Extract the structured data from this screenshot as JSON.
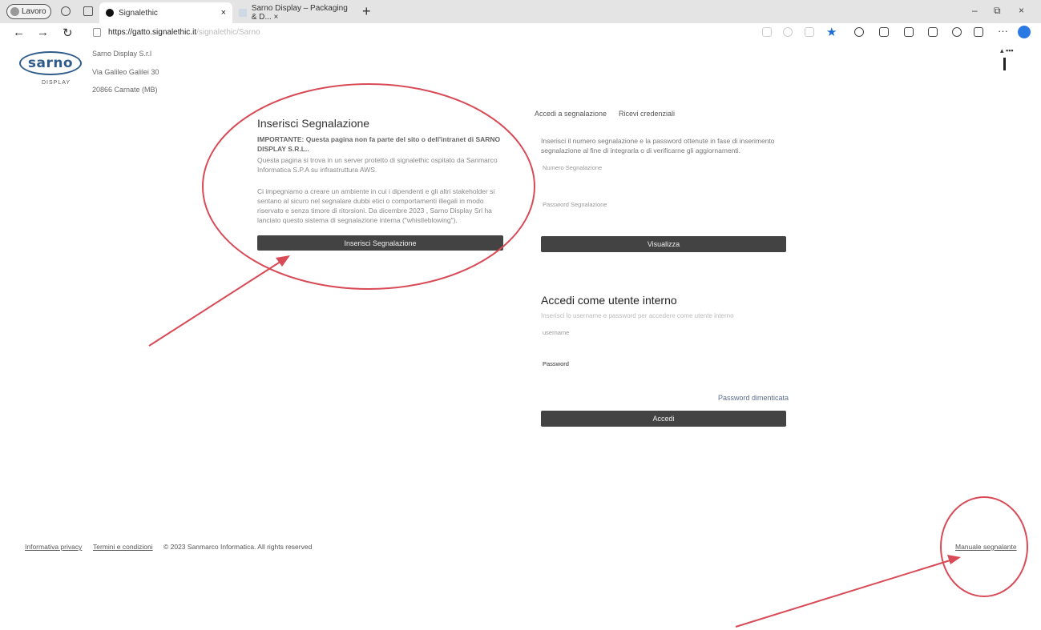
{
  "browser": {
    "profile_label": "Lavoro",
    "tabs": [
      {
        "title": "Signalethic",
        "close": "×"
      },
      {
        "title": "Sarno Display – Packaging & D... ×"
      }
    ],
    "new_tab": "+",
    "window_controls": [
      "–",
      "⧉",
      "×"
    ],
    "url_prefix": "https://gatto.signalethic.it",
    "url_faded": "/signalethic/Sarno",
    "more_label": "···"
  },
  "company": {
    "logo_text": "sarno",
    "logo_sub": "DISPLAY",
    "name": "Sarno Display S.r.l",
    "address": "Via Galileo Galilei 30",
    "city": "20866 Carnate (MB)"
  },
  "left": {
    "title": "Inserisci Segnalazione",
    "important": "IMPORTANTE: Questa pagina non fa parte del sito o dell'intranet di SARNO DISPLAY S.R.L..",
    "para1": "Questa pagina si trova in un server protetto di signalethic ospitato da Sanmarco Informatica S.P.A su infrastruttura AWS.",
    "para2": "Ci impegniamo a creare un ambiente in cui i dipendenti e gli altri stakeholder si sentano al sicuro nel segnalare dubbi etici o comportamenti illegali in modo riservato e senza timore di ritorsioni. Da dicembre 2023 , Sarno Display Srl ha lanciato questo sistema di segnalazione interna (\"whistleblowing\").",
    "button": "Inserisci Segnalazione"
  },
  "right": {
    "tabs": [
      "Accedi a segnalazione",
      "Ricevi credenziali"
    ],
    "intro": "Inserisci il numero segnalazione e la password ottenute in fase di inserimento segnalazione al fine di integrarla o di verificarne gli aggiornamenti.",
    "label_number": "Numero Segnalazione",
    "label_password": "Password Segnalazione",
    "view_button": "Visualizza",
    "internal_title": "Accedi come utente interno",
    "internal_sub": "Inserisci lo username e password per accedere come utente interno",
    "label_username": "username",
    "label_password2": "Password",
    "forgot": "Password dimenticata",
    "login_button": "Accedi"
  },
  "footer": {
    "privacy": "Informativa privacy",
    "terms": "Termini e condizioni",
    "copyright": "© 2023 Sanmarco Informatica. All rights reserved",
    "manual": "Manuale segnalante"
  },
  "annotation_color": "#d94a57"
}
